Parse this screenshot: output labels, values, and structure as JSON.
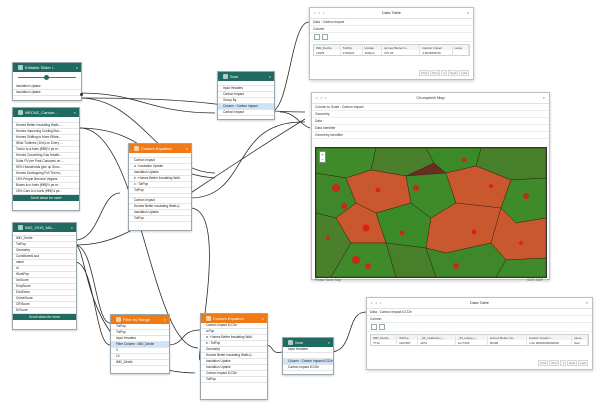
{
  "nodes": {
    "slider": {
      "title": "Editable Slider i..",
      "rows": [
        "Insulation Uptake",
        "Insulation Uptake"
      ]
    },
    "nrcan": {
      "title": "NRCNZ_Carbon...",
      "rows": [
        "Homes Better Insulating Walls ...",
        "Homes Improving Cooling Bou...",
        "Homes Shifting to More Efficie...",
        "Wind Turbines (10m) on Every ...",
        "Tonfor to a-fuels (€€€)½ pe.re...",
        "Homes Converting Gas Heatin...",
        "Solar PV per Park Canopies on ...",
        "50% Households give up Seco...",
        "Homes Undergoing Full Therm...",
        "15% People Become Vegans",
        "Buses to e-fuels (€€€)½ pe.re...",
        "15% Cars to e-fuels (€€€)½ pe..."
      ],
      "more": "Scroll down for more"
    },
    "imd": {
      "title": "IMD_2019_MA...",
      "rows": [
        "IMD_Decile",
        "TotPop",
        "Geometry",
        "ConstituentLsoa",
        "name",
        "id",
        "WorkPop",
        "IncScore",
        "EmpScore",
        "EduScore",
        "CrimeScore",
        "CRIScore",
        "DrScore"
      ],
      "more": "Scroll down for more"
    },
    "sum1": {
      "title": "Sum",
      "rows": [
        "Input Headers",
        "Carbon Impact",
        "Group By",
        "Column : Carbon Impact",
        "Carbon Impact"
      ]
    },
    "custom1": {
      "title": "Custom Equation",
      "rows": [
        "Carbon Impact",
        "a : Insulation Uptake",
        "Insulation Uptake",
        "b : Homes Better Insulating Wall..",
        "c : TotPop",
        "TotPop",
        "Carbon Impact",
        "Homes Better Insulating Walls (I..",
        "Insulation Uptake",
        "TotPop"
      ]
    },
    "filter": {
      "title": "Filter by Range",
      "rows": [
        "TotPop",
        "TotPop",
        "Input Headers",
        "Filter Column : IMD_Decile",
        "0",
        "10",
        "IMD_Decile"
      ]
    },
    "custom2": {
      "title": "Custom Equation",
      "rows": [
        "Carbon Impact tCO2e",
        "a:Pop",
        "a : Homes Better Insulating Wall..",
        "b : TotPop",
        "Geometry",
        "Homes Better Insulating Walls (I..",
        "Insulation Uptake",
        "Insulation Uptake",
        "Carbon Impact tCO2e",
        "TotPop"
      ]
    },
    "sum2": {
      "title": "Sum",
      "rows": [
        "Input Headers",
        "",
        "Column : Carbon Impact tCO2e",
        "Carbon Impact tCO2e"
      ]
    }
  },
  "panels": {
    "table1": {
      "title": "Data Table",
      "data_row": "Data : Carbon Impact",
      "column_label": "Column",
      "headers": [
        "IMD_Decile",
        "TotPop",
        "Uptake",
        "Homes Better In...",
        "Carbon Impact",
        "name"
      ],
      "cells": [
        "13525",
        "3793024",
        "1662e4",
        "376.36",
        "4.8248458.59",
        ""
      ],
      "pager": [
        "First",
        "Prev",
        "1",
        "Next",
        "Last"
      ]
    },
    "map": {
      "title": "Choropleth Map",
      "rows": [
        "Column to Scale : Carbon Impact",
        "Geometry",
        "Data",
        "Data Identifier",
        "Geometry Identifier"
      ],
      "zoom_in": "+",
      "zoom_out": "−",
      "footer_left": "Please Name Map",
      "footer_right": "SAVE MAP"
    },
    "table2": {
      "title": "Data Table",
      "data_row": "Data : Carbon Impact tCO2e",
      "column_label": "Column",
      "headers": [
        "IMD_Decile",
        "TotPop",
        "_64_insideolts_t...",
        "_64_totpop_r...",
        "Homes Better Ins...",
        "Carbon Impact t...",
        "name"
      ],
      "cells": [
        "7712",
        "1401507",
        "a57d",
        "1e77265",
        "60496",
        "1.6e 38000000000000",
        "Sum"
      ],
      "pager": [
        "First",
        "Prev",
        "1",
        "Next",
        "Last"
      ]
    }
  },
  "colors": {
    "teal_header": "#1f6b61",
    "orange_header": "#ef7a16",
    "highlight_row": "#cfe3f5",
    "map_dark": "#6a2e20",
    "map_green": "#3f8a2a",
    "map_orange": "#c9582e",
    "map_red": "#e01818"
  },
  "icons": {
    "close": "×",
    "node": "square-icon",
    "panel_dots": "• • •"
  }
}
